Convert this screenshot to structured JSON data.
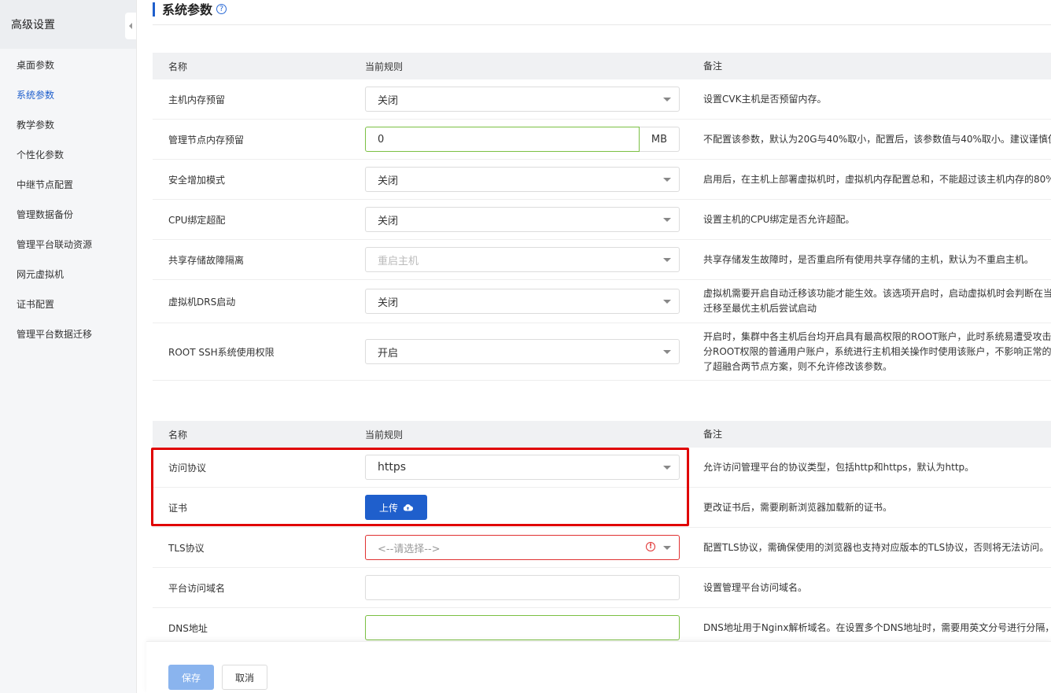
{
  "sidebar": {
    "title": "高级设置",
    "items": [
      "桌面参数",
      "系统参数",
      "教学参数",
      "个性化参数",
      "中继节点配置",
      "管理数据备份",
      "管理平台联动资源",
      "网元虚拟机",
      "证书配置",
      "管理平台数据迁移"
    ],
    "active_index": 1
  },
  "page": {
    "title": "系统参数",
    "help_icon": "?"
  },
  "table1": {
    "headers": [
      "名称",
      "当前规则",
      "备注"
    ],
    "rows": [
      {
        "name": "主机内存预留",
        "value": "关闭",
        "note": "设置CVK主机是否预留内存。"
      },
      {
        "name": "管理节点内存预留",
        "value": "0",
        "unit": "MB",
        "note": "不配置该参数，默认为20G与40%取小，配置后，该参数值与40%取小。建议谨慎使"
      },
      {
        "name": "安全增加模式",
        "value": "关闭",
        "note": "启用后，在主机上部署虚拟机时，虚拟机内存配置总和，不能超过该主机内存的80%"
      },
      {
        "name": "CPU绑定超配",
        "value": "关闭",
        "note": "设置主机的CPU绑定是否允许超配。"
      },
      {
        "name": "共享存储故障隔离",
        "value": "重启主机",
        "note": "共享存储发生故障时，是否重启所有使用共享存储的主机，默认为不重启主机。"
      },
      {
        "name": "虚拟机DRS启动",
        "value": "关闭",
        "note_l1": "虚拟机需要开启自动迁移该功能才能生效。该选项开启时，启动虚拟机时会判断在当",
        "note_l2": "迁移至最优主机后尝试启动"
      },
      {
        "name": "ROOT SSH系统使用权限",
        "value": "开启",
        "note_l1": "开启时，集群中各主机后台均开启具有最高权限的ROOT账户，此时系统易遭受攻击",
        "note_l2": "分ROOT权限的普通用户账户，系统进行主机相关操作时使用该账户，不影响正常的",
        "note_l3": "了超融合两节点方案，则不允许修改该参数。"
      }
    ]
  },
  "table2": {
    "headers": [
      "名称",
      "当前规则",
      "备注"
    ],
    "rows": [
      {
        "name": "访问协议",
        "value": "https",
        "note": "允许访问管理平台的协议类型，包括http和https，默认为http。"
      },
      {
        "name": "证书",
        "button": "上传",
        "note": "更改证书后，需要刷新浏览器加载新的证书。"
      },
      {
        "name": "TLS协议",
        "placeholder": "<--请选择-->",
        "note": "配置TLS协议，需确保使用的浏览器也支持对应版本的TLS协议，否则将无法访问。"
      },
      {
        "name": "平台访问域名",
        "value": "",
        "note": "设置管理平台访问域名。"
      },
      {
        "name": "DNS地址",
        "value": "",
        "note": "DNS地址用于Nginx解析域名。在设置多个DNS地址时，需要用英文分号进行分隔，"
      }
    ]
  },
  "footer": {
    "save": "保存",
    "cancel": "取消"
  },
  "colors": {
    "accent": "#1f5fcc",
    "highlight": "#e00000",
    "valid": "#7bc043",
    "error": "#e03131"
  }
}
